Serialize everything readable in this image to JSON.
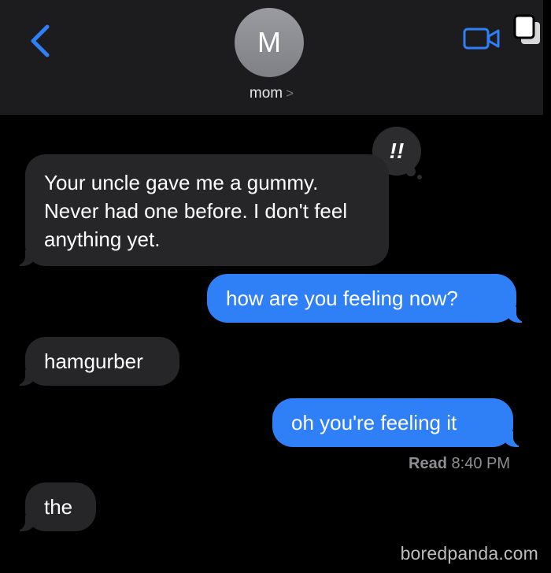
{
  "header": {
    "avatar_initial": "M",
    "contact_name": "mom",
    "contact_chevron": ">",
    "back_icon": "chevron-left-icon",
    "video_icon": "video-camera-icon",
    "accent_color": "#2f7ff7"
  },
  "messages": [
    {
      "direction": "incoming",
      "text": "Your uncle gave me a gummy. Never had one before. I don't feel anything yet.",
      "reaction": "!!"
    },
    {
      "direction": "outgoing",
      "text": "how are you feeling now?"
    },
    {
      "direction": "incoming",
      "text": "hamgurber"
    },
    {
      "direction": "outgoing",
      "text": "oh you're feeling it"
    },
    {
      "direction": "incoming",
      "text": "the"
    }
  ],
  "read_receipt": {
    "label": "Read",
    "time": "8:40 PM"
  },
  "watermark": "boredpanda.com",
  "colors": {
    "incoming_bubble": "#262628",
    "outgoing_bubble": "#2f7ff7",
    "background": "#000000"
  }
}
